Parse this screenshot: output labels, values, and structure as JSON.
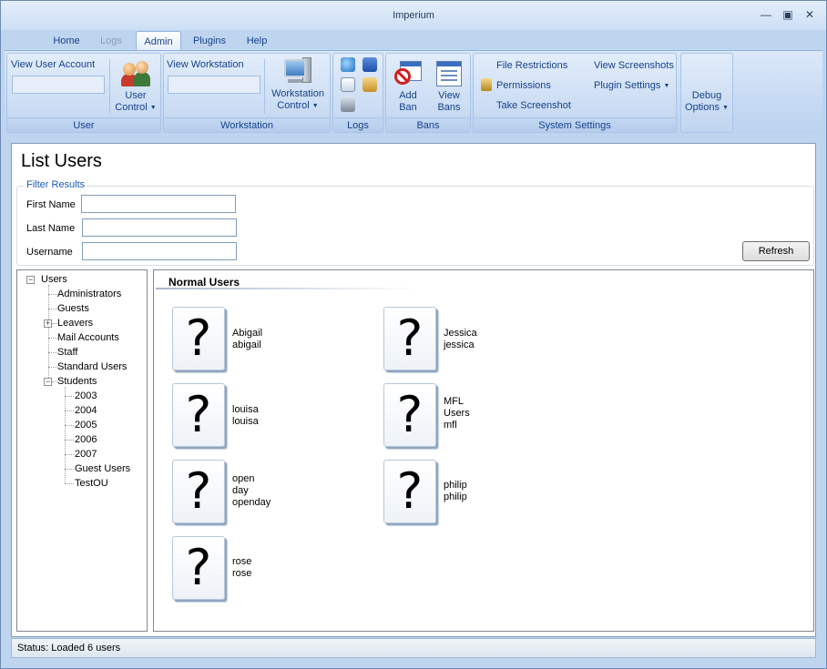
{
  "window": {
    "title": "Imperium"
  },
  "tabs": [
    {
      "label": "Home",
      "state": "normal"
    },
    {
      "label": "Logs",
      "state": "disabled"
    },
    {
      "label": "Admin",
      "state": "active"
    },
    {
      "label": "Plugins",
      "state": "normal"
    },
    {
      "label": "Help",
      "state": "normal"
    }
  ],
  "ribbon": {
    "user": {
      "view_label": "View User Account",
      "control_l1": "User",
      "control_l2": "Control",
      "group": "User"
    },
    "workstation": {
      "view_label": "View Workstation",
      "control_l1": "Workstation",
      "control_l2": "Control",
      "group": "Workstation"
    },
    "logs": {
      "group": "Logs"
    },
    "bans": {
      "add_l1": "Add",
      "add_l2": "Ban",
      "view_l1": "View",
      "view_l2": "Bans",
      "group": "Bans"
    },
    "system": {
      "file_restrictions": "File Restrictions",
      "permissions": "Permissions",
      "take_screenshot": "Take Screenshot",
      "view_screenshots": "View Screenshots",
      "plugin_settings": "Plugin Settings",
      "group": "System Settings"
    },
    "debug": {
      "l1": "Debug",
      "l2": "Options"
    }
  },
  "page": {
    "title": "List Users"
  },
  "filter": {
    "legend": "Filter Results",
    "first_name_label": "First Name",
    "last_name_label": "Last Name",
    "username_label": "Username",
    "refresh_label": "Refresh"
  },
  "tree": {
    "root": "Users",
    "items": [
      "Administrators",
      "Guests",
      "Leavers",
      "Mail Accounts",
      "Staff",
      "Standard Users",
      "Students"
    ],
    "students": [
      "2003",
      "2004",
      "2005",
      "2006",
      "2007",
      "Guest Users",
      "TestOU"
    ]
  },
  "users_section": "Normal Users",
  "users": [
    {
      "lines": [
        "Abigail",
        "abigail"
      ]
    },
    {
      "lines": [
        "Jessica",
        "jessica"
      ]
    },
    {
      "lines": [
        "louisa",
        "louisa"
      ]
    },
    {
      "lines": [
        "MFL",
        "Users",
        "mfl"
      ]
    },
    {
      "lines": [
        "open",
        "day",
        "openday"
      ]
    },
    {
      "lines": [
        "philip",
        "philip"
      ]
    },
    {
      "lines": [
        "rose",
        "rose"
      ]
    }
  ],
  "status": "Status:  Loaded 6 users",
  "icons": {
    "unknown_user_glyph": "?"
  }
}
